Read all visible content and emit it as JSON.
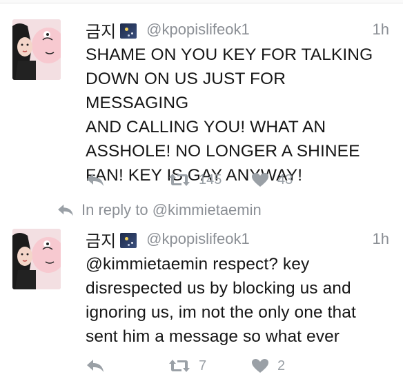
{
  "tweets": [
    {
      "name": "금지",
      "handle": "@kpopislifeok1",
      "time": "1h",
      "text": "SHAME ON YOU KEY FOR TALKING\nDOWN ON US JUST FOR MESSAGING\nAND CALLING YOU! WHAT AN\nASSHOLE! NO LONGER A SHINEE\nFAN! KEY IS GAY ANYWAY!",
      "retweets": "145",
      "likes": "43"
    },
    {
      "name": "금지",
      "handle": "@kpopislifeok1",
      "time": "1h",
      "text": "@kimmietaemin respect? key\ndisrespected us by blocking us and\nignoring us, im not the only one that\nsent him a message so what ever",
      "retweets": "7",
      "likes": "2"
    }
  ],
  "in_reply": {
    "label": "In reply to @kimmietaemin"
  },
  "icons": {
    "reply": "reply-icon",
    "retweet": "retweet-icon",
    "like": "heart-icon",
    "badge": "night-sky-emoji-icon"
  },
  "colors": {
    "text": "#161616",
    "muted": "#8b8f95",
    "icon": "#9aa0a6"
  }
}
